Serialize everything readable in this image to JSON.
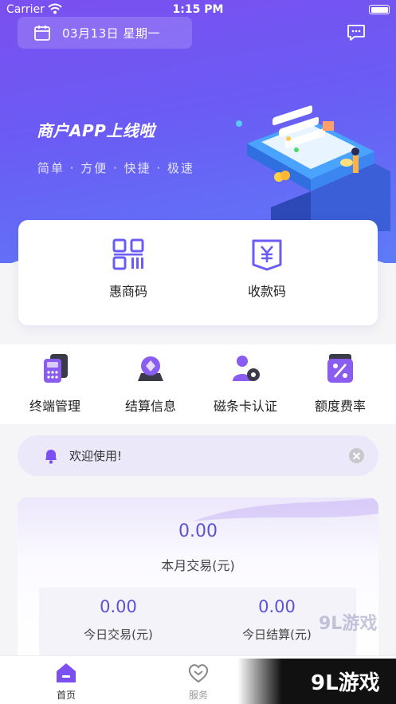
{
  "status_bar": {
    "carrier": "Carrier",
    "time": "1:15 PM"
  },
  "header": {
    "date": "03月13日 星期一"
  },
  "banner": {
    "title": "商户APP上线啦",
    "subtitle": "简单 · 方便 · 快捷 · 极速"
  },
  "quick_actions": [
    {
      "label": "惠商码",
      "icon": "qr-code-icon"
    },
    {
      "label": "收款码",
      "icon": "yuan-receipt-icon"
    }
  ],
  "menu": [
    {
      "label": "终端管理",
      "icon": "pos-terminal-icon"
    },
    {
      "label": "结算信息",
      "icon": "settlement-icon"
    },
    {
      "label": "磁条卡认证",
      "icon": "card-auth-icon"
    },
    {
      "label": "额度费率",
      "icon": "rate-icon"
    }
  ],
  "notice": {
    "text": "欢迎使用!"
  },
  "stats": {
    "month_value": "0.00",
    "month_label": "本月交易(元)",
    "today_trade_value": "0.00",
    "today_trade_label": "今日交易(元)",
    "today_settle_value": "0.00",
    "today_settle_label": "今日结算(元)"
  },
  "tabbar": [
    {
      "label": "首页",
      "icon": "home-icon",
      "active": true
    },
    {
      "label": "服务",
      "icon": "service-heart-icon",
      "active": false
    }
  ],
  "watermark": {
    "text": "9L游戏",
    "text_small": "9L游戏"
  },
  "colors": {
    "accent": "#6a5cf4",
    "value": "#5b52d4"
  }
}
